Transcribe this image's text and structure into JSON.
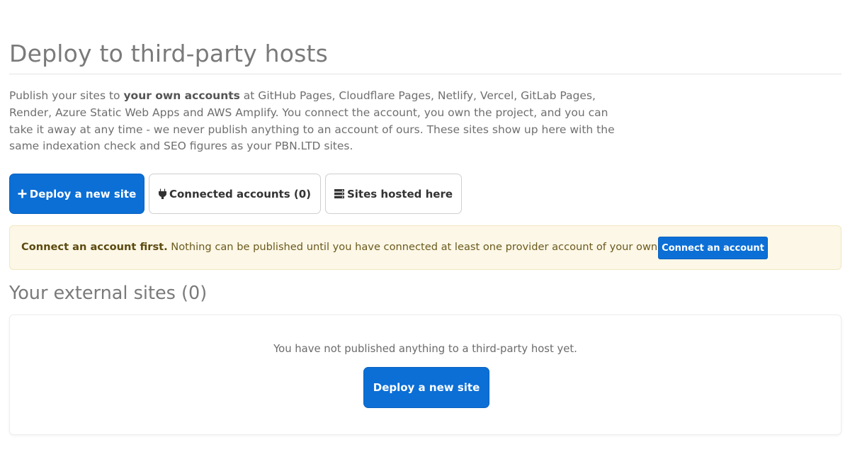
{
  "page": {
    "title": "Deploy to third-party hosts",
    "intro": {
      "prefix": "Publish your sites to ",
      "emphasis": "your own accounts",
      "suffix": " at GitHub Pages, Cloudflare Pages, Netlify, Vercel, GitLab Pages, Render, Azure Static Web Apps and AWS Amplify. You connect the account, you own the project, and you can take it away at any time - we never publish anything to an account of ours. These sites show up here with the same indexation check and SEO figures as your PBN.LTD sites."
    }
  },
  "actions": {
    "deploy_label": "Deploy a new site",
    "deploy_icon": "plus-icon",
    "connected_label": "Connected accounts (0)",
    "connected_icon": "plug-icon",
    "hosted_label": "Sites hosted here",
    "hosted_icon": "server-icon"
  },
  "alert": {
    "strong": "Connect an account first.",
    "message": " Nothing can be published until you have connected at least one provider account of your own.",
    "button_label": "Connect an account"
  },
  "external_sites": {
    "title": "Your external sites (0)",
    "empty_message": "You have not published anything to a third-party host yet.",
    "button_label": "Deploy a new site"
  },
  "colors": {
    "primary": "#0b6fd6",
    "alert_bg": "#fcf7e6",
    "alert_text": "#6b5a1e"
  }
}
